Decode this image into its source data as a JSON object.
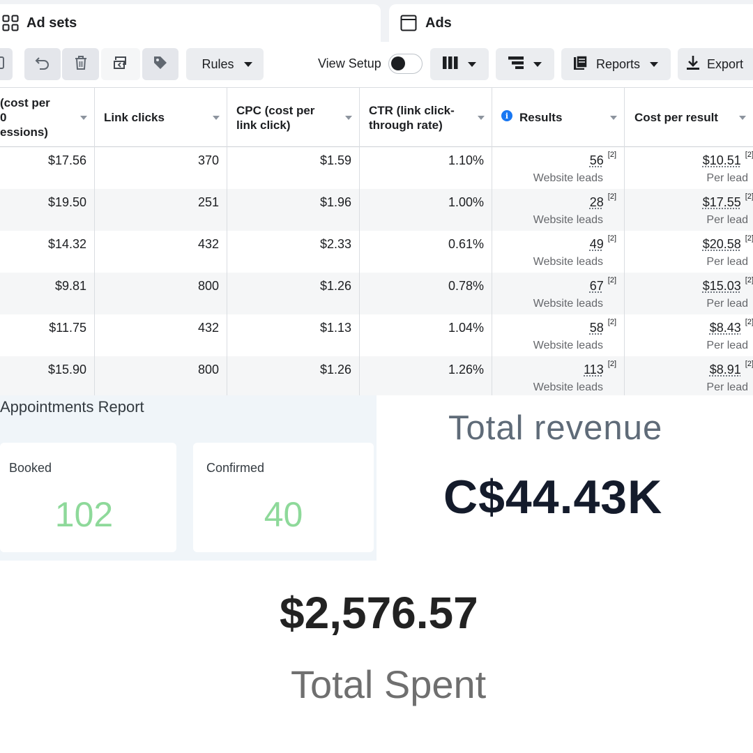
{
  "tabs": [
    {
      "label": "Ad sets",
      "icon": "grid-icon"
    },
    {
      "label": "Ads",
      "icon": "window-icon"
    }
  ],
  "toolbar": {
    "icons": [
      "edit-icon",
      "undo-icon",
      "trash-icon",
      "duplicate-icon",
      "tag-icon"
    ],
    "rules_label": "Rules",
    "view_setup_label": "View Setup",
    "view_setup_enabled": false,
    "columns_icon": "columns-icon",
    "breakdown_icon": "breakdown-icon",
    "reports_label": "Reports",
    "export_label": "Export"
  },
  "table": {
    "columns": [
      "(cost per\n0\nessions)",
      "Link clicks",
      "CPC (cost per\nlink click)",
      "CTR (link click-\nthrough rate)",
      "Results",
      "Cost per result"
    ],
    "rows": [
      {
        "cpm": "$17.56",
        "link_clicks": "370",
        "cpc": "$1.59",
        "ctr": "1.10%",
        "results": "56",
        "results_sub": "Website leads",
        "cost_per_result": "$10.51",
        "cost_sub": "Per lead"
      },
      {
        "cpm": "$19.50",
        "link_clicks": "251",
        "cpc": "$1.96",
        "ctr": "1.00%",
        "results": "28",
        "results_sub": "Website leads",
        "cost_per_result": "$17.55",
        "cost_sub": "Per lead"
      },
      {
        "cpm": "$14.32",
        "link_clicks": "432",
        "cpc": "$2.33",
        "ctr": "0.61%",
        "results": "49",
        "results_sub": "Website leads",
        "cost_per_result": "$20.58",
        "cost_sub": "Per lead"
      },
      {
        "cpm": "$9.81",
        "link_clicks": "800",
        "cpc": "$1.26",
        "ctr": "0.78%",
        "results": "67",
        "results_sub": "Website leads",
        "cost_per_result": "$15.03",
        "cost_sub": "Per lead"
      },
      {
        "cpm": "$11.75",
        "link_clicks": "432",
        "cpc": "$1.13",
        "ctr": "1.04%",
        "results": "58",
        "results_sub": "Website leads",
        "cost_per_result": "$8.43",
        "cost_sub": "Per lead"
      },
      {
        "cpm": "$15.90",
        "link_clicks": "800",
        "cpc": "$1.26",
        "ctr": "1.26%",
        "results": "113",
        "results_sub": "Website leads",
        "cost_per_result": "$8.91",
        "cost_sub": "Per lead"
      }
    ],
    "footnote_marker": "[2]"
  },
  "appointments": {
    "title": "Appointments Report",
    "booked_label": "Booked",
    "booked_value": "102",
    "confirmed_label": "Confirmed",
    "confirmed_value": "40",
    "value_color": "#8ed99a"
  },
  "revenue": {
    "label": "Total revenue",
    "value": "C$44.43K"
  },
  "spent": {
    "value": "$2,576.57",
    "label": "Total Spent"
  },
  "colors": {
    "accent": "#1877f2",
    "toolbar_button": "#ebedf0",
    "row_alt": "#f5f6f7"
  }
}
